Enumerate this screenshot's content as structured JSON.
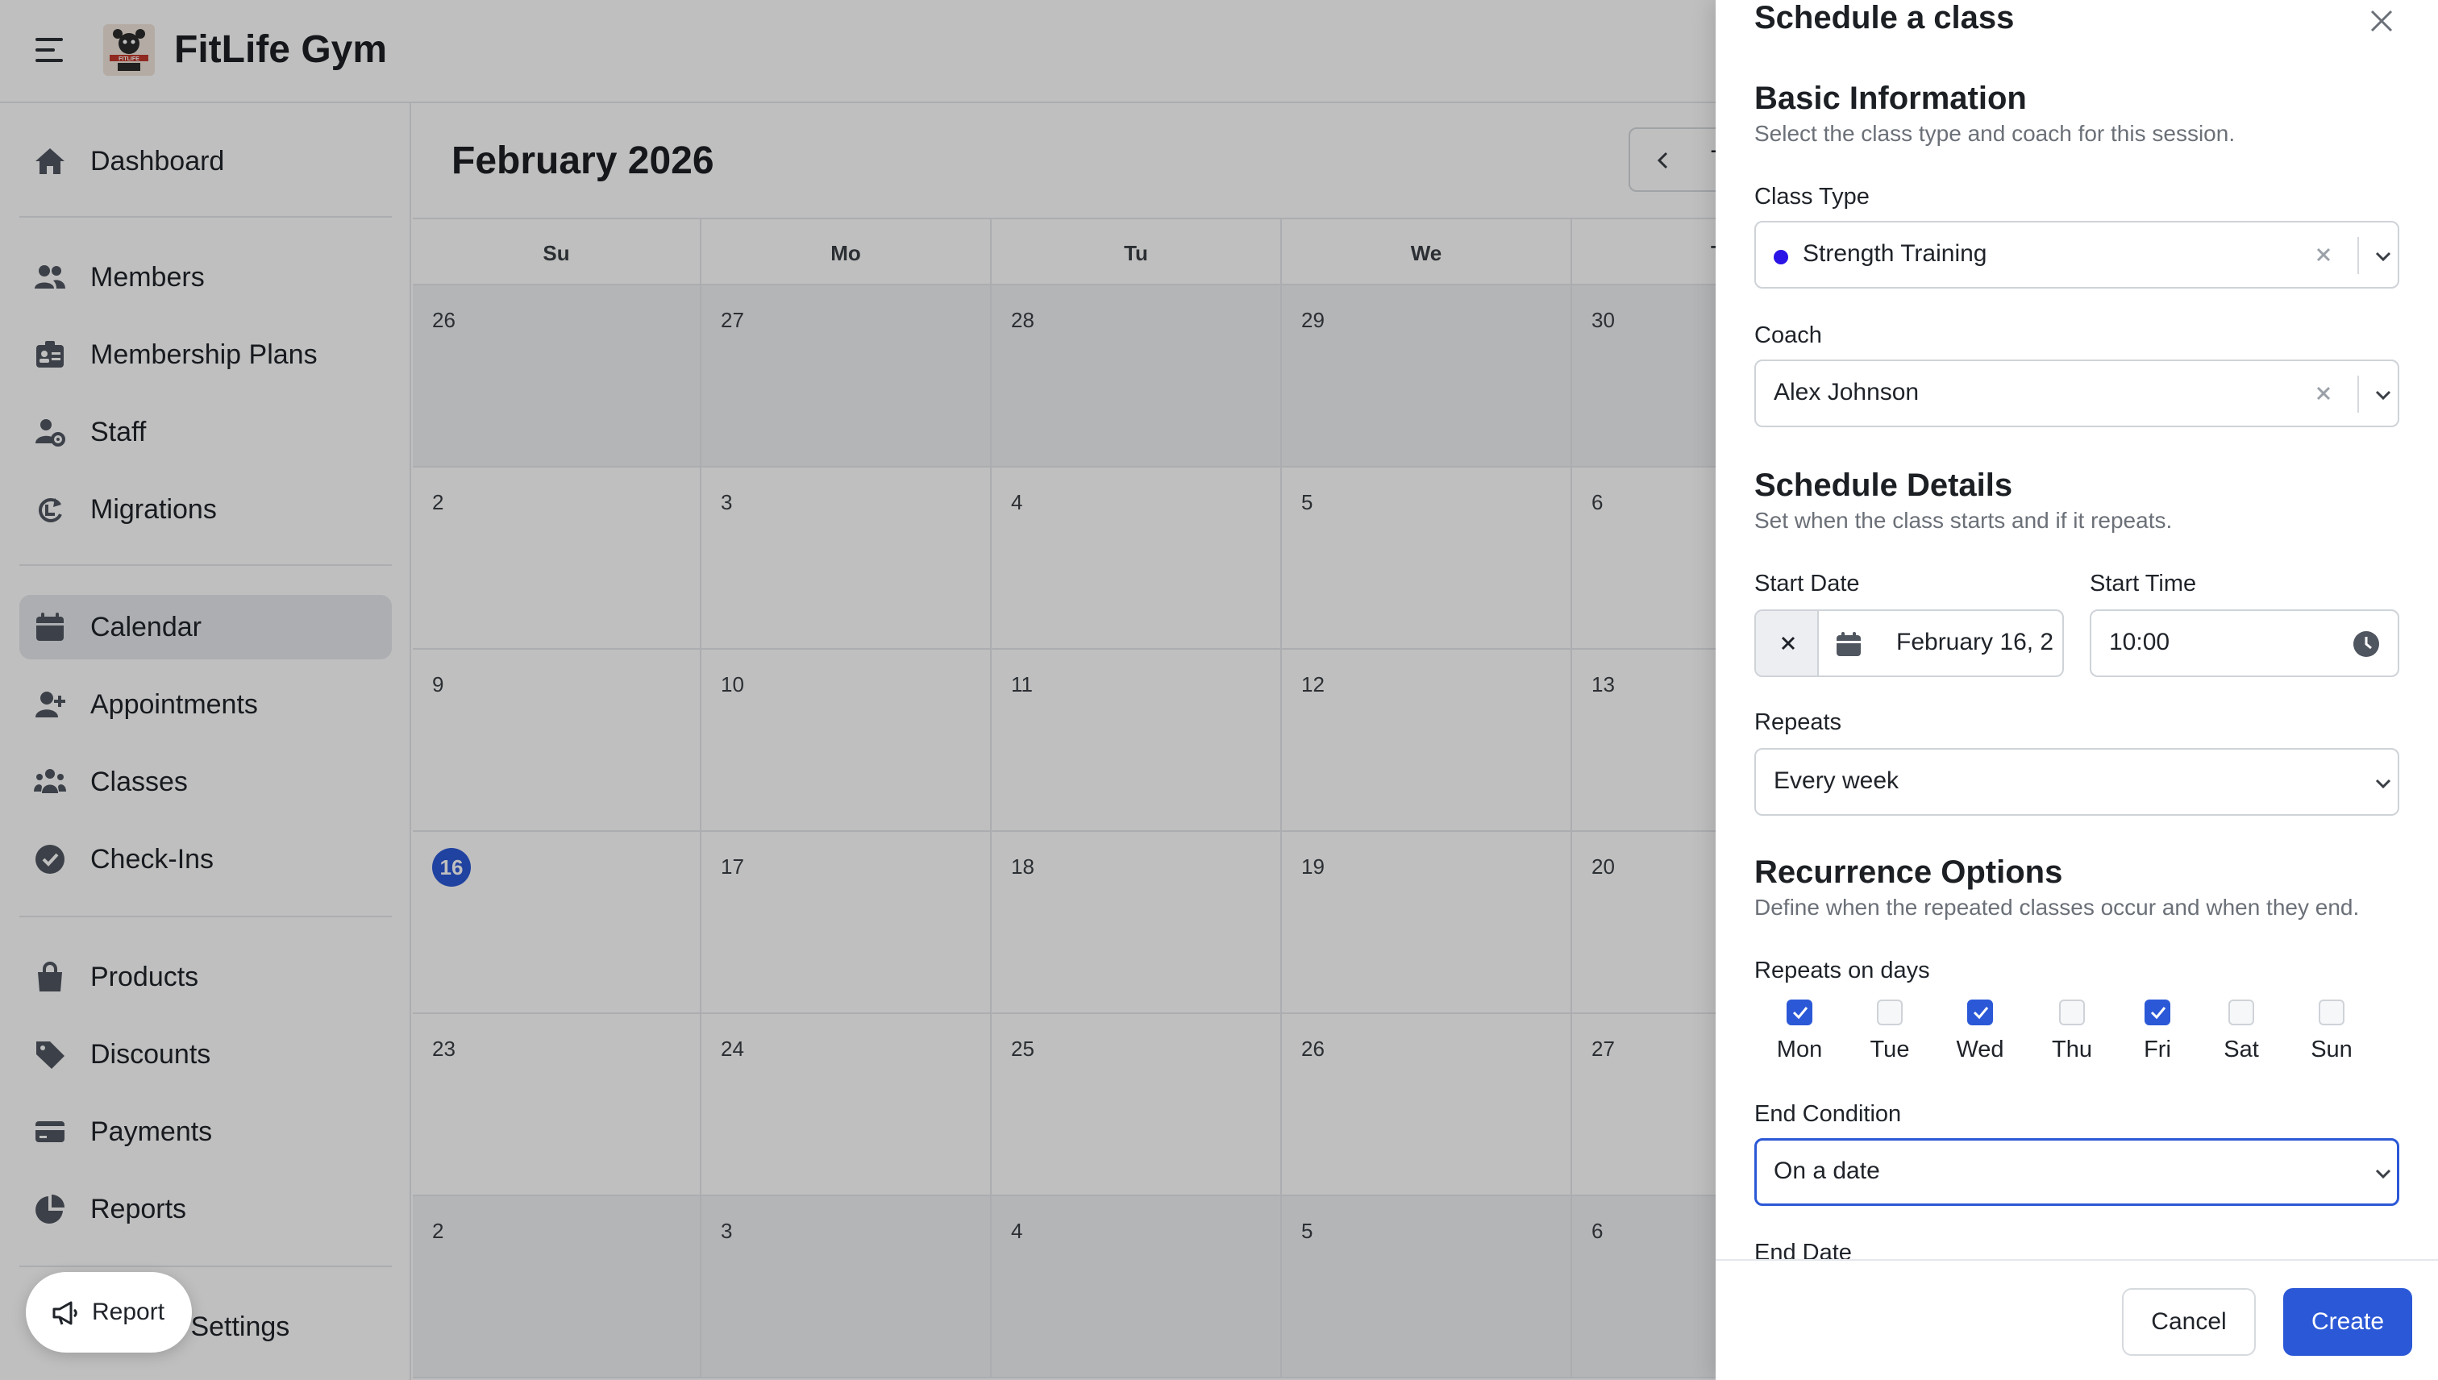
{
  "app": {
    "title": "FitLife Gym",
    "logo_text": "FITLIFE"
  },
  "sidebar": {
    "items": [
      {
        "label": "Dashboard",
        "icon": "home-icon"
      },
      {
        "label": "Members",
        "icon": "users-icon"
      },
      {
        "label": "Membership Plans",
        "icon": "id-card-icon"
      },
      {
        "label": "Staff",
        "icon": "staff-gear-icon"
      },
      {
        "label": "Migrations",
        "icon": "migrate-icon"
      },
      {
        "label": "Calendar",
        "icon": "calendar-icon",
        "active": true
      },
      {
        "label": "Appointments",
        "icon": "user-plus-icon"
      },
      {
        "label": "Classes",
        "icon": "group-icon"
      },
      {
        "label": "Check-Ins",
        "icon": "check-circle-icon"
      },
      {
        "label": "Products",
        "icon": "bag-icon"
      },
      {
        "label": "Discounts",
        "icon": "tag-icon"
      },
      {
        "label": "Payments",
        "icon": "credit-card-icon"
      },
      {
        "label": "Reports",
        "icon": "pie-chart-icon"
      },
      {
        "label": "s Settings",
        "icon": "settings-icon"
      }
    ]
  },
  "report_button": {
    "label": "Report"
  },
  "calendar": {
    "month_title": "February 2026",
    "today_button_partial": "T",
    "weekdays": [
      "Su",
      "Mo",
      "Tu",
      "We",
      "T"
    ],
    "weeks": [
      [
        "26",
        "27",
        "28",
        "29",
        "30"
      ],
      [
        "2",
        "3",
        "4",
        "5",
        "6"
      ],
      [
        "9",
        "10",
        "11",
        "12",
        "13"
      ],
      [
        "16",
        "17",
        "18",
        "19",
        "20"
      ],
      [
        "23",
        "24",
        "25",
        "26",
        "27"
      ],
      [
        "2",
        "3",
        "4",
        "5",
        "6"
      ]
    ],
    "today": "16"
  },
  "drawer": {
    "title": "Schedule a class",
    "basic": {
      "title": "Basic Information",
      "desc": "Select the class type and coach for this session.",
      "class_type_label": "Class Type",
      "class_type_value": "Strength Training",
      "class_type_color": "#2b14e6",
      "coach_label": "Coach",
      "coach_value": "Alex Johnson"
    },
    "schedule": {
      "title": "Schedule Details",
      "desc": "Set when the class starts and if it repeats.",
      "start_date_label": "Start Date",
      "start_date_value": "February 16, 2",
      "start_time_label": "Start Time",
      "start_time_value": "10:00",
      "repeats_label": "Repeats",
      "repeats_value": "Every week"
    },
    "recurrence": {
      "title": "Recurrence Options",
      "desc": "Define when the repeated classes occur and when they end.",
      "days_label": "Repeats on days",
      "days": [
        {
          "label": "Mon",
          "checked": true
        },
        {
          "label": "Tue",
          "checked": false
        },
        {
          "label": "Wed",
          "checked": true
        },
        {
          "label": "Thu",
          "checked": false
        },
        {
          "label": "Fri",
          "checked": true
        },
        {
          "label": "Sat",
          "checked": false
        },
        {
          "label": "Sun",
          "checked": false
        }
      ],
      "end_condition_label": "End Condition",
      "end_condition_value": "On a date",
      "end_date_label": "End Date"
    },
    "footer": {
      "cancel": "Cancel",
      "create": "Create"
    }
  },
  "colors": {
    "accent": "#2b58d6",
    "class_dot": "#2b14e6"
  }
}
